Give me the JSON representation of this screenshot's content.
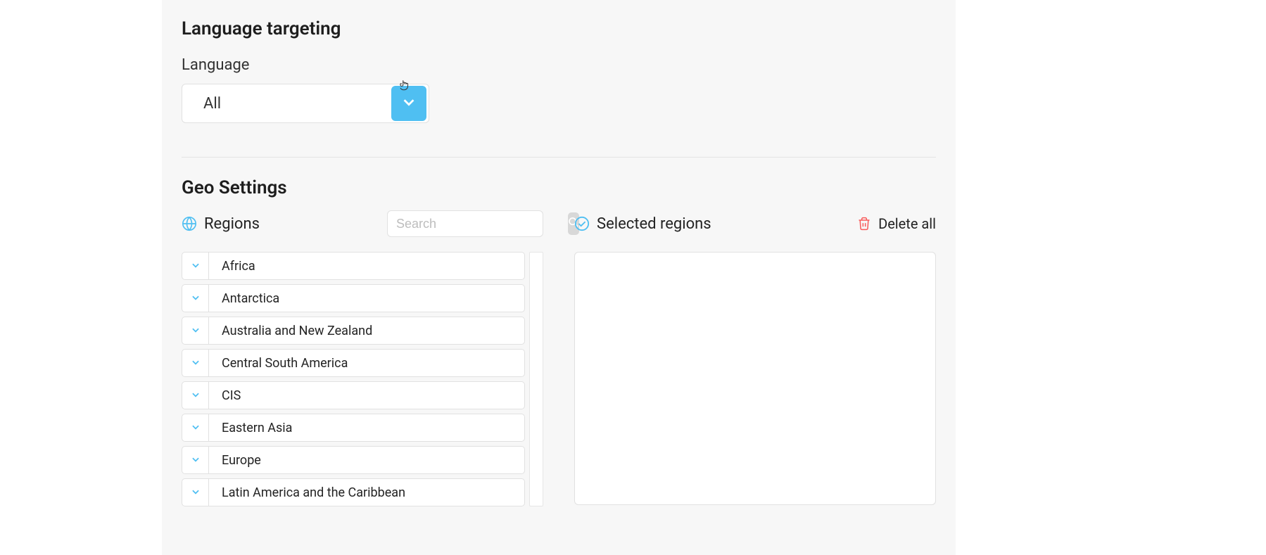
{
  "language_targeting": {
    "section_title": "Language targeting",
    "field_label": "Language",
    "selected_value": "All"
  },
  "geo_settings": {
    "section_title": "Geo Settings",
    "regions_label": "Regions",
    "selected_regions_label": "Selected regions",
    "delete_all_label": "Delete all",
    "search_placeholder": "Search",
    "regions": [
      {
        "label": "Africa"
      },
      {
        "label": "Antarctica"
      },
      {
        "label": "Australia and New Zealand"
      },
      {
        "label": "Central South America"
      },
      {
        "label": "CIS"
      },
      {
        "label": "Eastern Asia"
      },
      {
        "label": "Europe"
      },
      {
        "label": "Latin America and the Caribbean"
      }
    ]
  }
}
